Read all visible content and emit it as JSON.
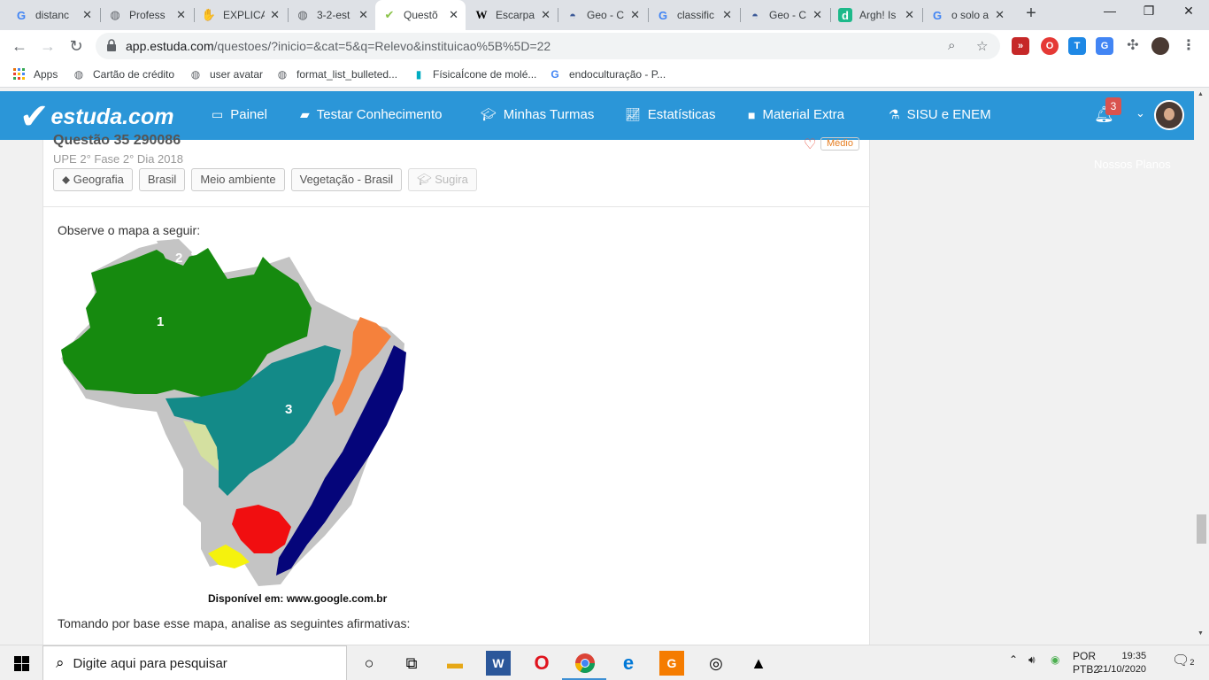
{
  "browser": {
    "tabs": [
      {
        "label": "distanc",
        "icon": "google-icon"
      },
      {
        "label": "Profess",
        "icon": "globe-icon"
      },
      {
        "label": "EXPLICA",
        "icon": "hand-icon"
      },
      {
        "label": "3-2-est",
        "icon": "globe-icon"
      },
      {
        "label": "Questõ",
        "icon": "estuda-icon",
        "active": true
      },
      {
        "label": "Escarpa",
        "icon": "wikipedia-icon"
      },
      {
        "label": "Geo - C",
        "icon": "site-icon"
      },
      {
        "label": "classific",
        "icon": "google-icon"
      },
      {
        "label": "Geo - C",
        "icon": "site-icon"
      },
      {
        "label": "Argh! Is",
        "icon": "d-icon"
      },
      {
        "label": "o solo a",
        "icon": "google-icon"
      }
    ],
    "url_host": "app.estuda.com",
    "url_path": "/questoes/?inicio=&cat=5&q=Relevo&instituicao%5B%5D=22",
    "bookmarks": [
      {
        "label": "Apps",
        "icon": "apps-grid-icon"
      },
      {
        "label": "Cartão de crédito",
        "icon": "globe-icon"
      },
      {
        "label": "user avatar",
        "icon": "globe-icon"
      },
      {
        "label": "format_list_bulleted...",
        "icon": "globe-icon"
      },
      {
        "label": "FísicaÍcone de molé...",
        "icon": "bookmark-icon"
      },
      {
        "label": "endoculturação - P...",
        "icon": "google-icon"
      }
    ]
  },
  "site": {
    "logo": "estuda.com",
    "nav": [
      {
        "label": "Painel",
        "icon": "monitor-icon"
      },
      {
        "label": "Testar Conhecimento",
        "icon": "book-icon"
      },
      {
        "label": "Minhas Turmas",
        "icon": "graduation-cap-icon"
      },
      {
        "label": "Estatísticas",
        "icon": "chart-icon"
      },
      {
        "label": "Material Extra",
        "icon": "video-icon"
      },
      {
        "label": "SISU e ENEM",
        "icon": "flask-icon"
      }
    ],
    "notifications": "3",
    "nossos_planos": "Nossos Planos"
  },
  "question": {
    "title": "Questão 35 290086",
    "meta": "UPE 2° Fase 2° Dia 2018",
    "level": "Médio",
    "tags": [
      "Geografia",
      "Brasil",
      "Meio ambiente",
      "Vegetação - Brasil",
      "Sugira"
    ],
    "prompt": "Observe o mapa a seguir:",
    "map_labels": [
      "1",
      "2",
      "3"
    ],
    "caption": "Disponível em: www.google.com.br",
    "question_text": "Tomando por base esse mapa, analise as seguintes afirmativas:"
  },
  "taskbar": {
    "search_placeholder": "Digite aqui para pesquisar",
    "lang_top": "POR",
    "lang_bottom": "PTB2",
    "time": "19:35",
    "date": "21/10/2020",
    "notif_count": "2"
  },
  "colors": {
    "header_blue": "#2b96d8",
    "region1_green": "#168a0f",
    "region3_teal": "#138a88",
    "coastal_navy": "#05057a",
    "orange": "#f5813c",
    "red": "#f10e10",
    "yellow": "#f5f20d",
    "gray": "#c4c4c4"
  }
}
